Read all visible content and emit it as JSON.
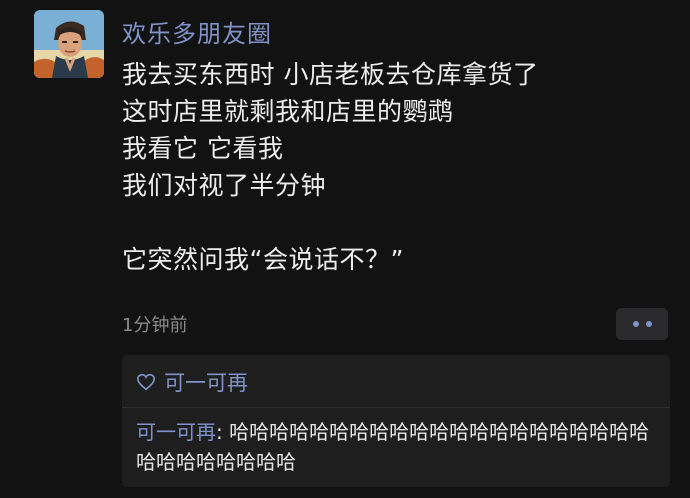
{
  "post": {
    "username": "欢乐多朋友圈",
    "lines": [
      "我去买东西时 小店老板去仓库拿货了",
      "这时店里就剩我和店里的鹦鹉",
      "我看它 它看我",
      "我们对视了半分钟",
      "",
      "它突然问我“会说话不？”"
    ],
    "timestamp": "1分钟前"
  },
  "likes": {
    "icon": "heart-outline-icon",
    "names": [
      "可一可再"
    ]
  },
  "comments": [
    {
      "author": "可一可再",
      "separator": ": ",
      "text": "哈哈哈哈哈哈哈哈哈哈哈哈哈哈哈哈哈哈哈哈哈哈哈哈哈哈哈哈哈"
    }
  ],
  "colors": {
    "background": "#121212",
    "accent": "#7f93c9",
    "text": "#ececec",
    "muted": "#8a8a8a",
    "panel": "#1e1e1f"
  }
}
